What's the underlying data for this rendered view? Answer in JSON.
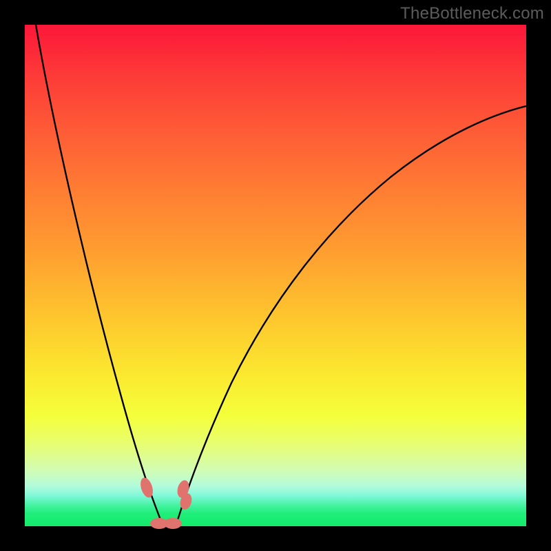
{
  "watermark": "TheBottleneck.com",
  "colors": {
    "frame": "#000000",
    "gradient_top": "#fc1739",
    "gradient_mid": "#fec52e",
    "gradient_bottom": "#13ec6c",
    "curve": "#000000",
    "marker": "#e0736e"
  },
  "chart_data": {
    "type": "line",
    "title": "",
    "xlabel": "",
    "ylabel": "",
    "xlim": [
      0,
      100
    ],
    "ylim": [
      0,
      100
    ],
    "series": [
      {
        "name": "left-curve",
        "x": [
          2,
          4,
          6,
          8,
          10,
          12,
          14,
          16,
          18,
          20,
          22,
          24,
          25.5,
          26.5
        ],
        "y": [
          100,
          92,
          84,
          76,
          67,
          59,
          50,
          41,
          32,
          23,
          14,
          6,
          2,
          0
        ]
      },
      {
        "name": "right-curve",
        "x": [
          30,
          31,
          33,
          36,
          40,
          45,
          51,
          58,
          66,
          75,
          85,
          95,
          100
        ],
        "y": [
          0,
          3,
          9,
          17,
          27,
          37,
          47,
          56,
          64,
          71,
          77,
          81,
          83
        ]
      }
    ],
    "markers": [
      {
        "name": "left-marker",
        "x": 24.0,
        "y": 6.0
      },
      {
        "name": "right-upper-marker",
        "x": 31.0,
        "y": 6.5
      },
      {
        "name": "right-lower-marker",
        "x": 31.5,
        "y": 4.5
      },
      {
        "name": "valley-left-marker",
        "x": 26.0,
        "y": 0.5
      },
      {
        "name": "valley-right-marker",
        "x": 29.0,
        "y": 0.5
      }
    ],
    "annotations": []
  }
}
